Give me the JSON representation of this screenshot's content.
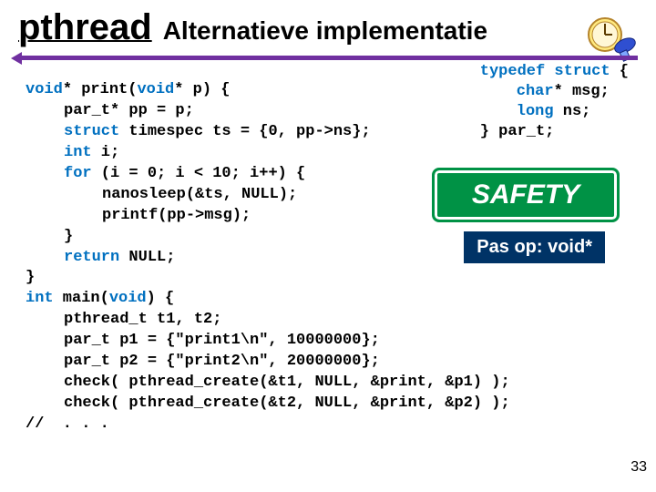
{
  "header": {
    "main": "pthread",
    "sub": "Alternatieve implementatie"
  },
  "struct": {
    "l1a": "typedef struct",
    "l1b": " {",
    "l2a": "char",
    "l2b": "* msg;",
    "l3a": "long",
    "l3b": " ns;",
    "l4": "} par_t;"
  },
  "code": {
    "l1a": "void",
    "l1b": "* print(",
    "l1c": "void",
    "l1d": "* p) {",
    "l2": "par_t* pp = p;",
    "l3a": "struct",
    "l3b": " timespec ts = {0, pp->ns};",
    "l4a": "int",
    "l4b": " i;",
    "l5a": "for",
    "l5b": " (i = 0; i < 10; i++) {",
    "l6": "nanosleep(&ts, NULL);",
    "l7": "printf(pp->msg);",
    "l8": "}",
    "l9a": "return",
    "l9b": " NULL;",
    "l10": "}",
    "l11a": "int",
    "l11b": " main(",
    "l11c": "void",
    "l11d": ") {",
    "l12": "pthread_t t1, t2;",
    "l13": "par_t p1 = {\"print1\\n\", 10000000};",
    "l14": "par_t p2 = {\"print2\\n\", 20000000};",
    "l15": "check( pthread_create(&t1, NULL, &print, &p1) );",
    "l16": "check( pthread_create(&t2, NULL, &print, &p2) );",
    "l17": "//  . . ."
  },
  "safety": "SAFETY",
  "warn": "Pas op: void*",
  "page": "33",
  "icons": {
    "clock": "clock-satellite-icon"
  }
}
